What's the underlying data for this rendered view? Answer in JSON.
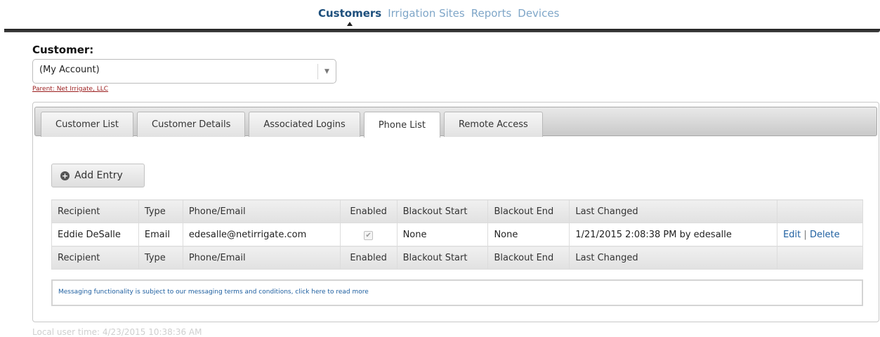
{
  "nav": {
    "items": [
      {
        "label": "Customers",
        "active": true
      },
      {
        "label": "Irrigation Sites",
        "active": false
      },
      {
        "label": "Reports",
        "active": false
      },
      {
        "label": "Devices",
        "active": false
      }
    ]
  },
  "customer": {
    "label": "Customer:",
    "selected": "(My Account)",
    "parent_link": "Parent: Net Irrigate, LLC"
  },
  "tabs": [
    {
      "label": "Customer List",
      "active": false
    },
    {
      "label": "Customer Details",
      "active": false
    },
    {
      "label": "Associated Logins",
      "active": false
    },
    {
      "label": "Phone List",
      "active": true
    },
    {
      "label": "Remote Access",
      "active": false
    }
  ],
  "phone_list": {
    "add_button": "Add Entry",
    "columns": [
      "Recipient",
      "Type",
      "Phone/Email",
      "Enabled",
      "Blackout Start",
      "Blackout End",
      "Last Changed",
      ""
    ],
    "rows": [
      {
        "recipient": "Eddie DeSalle",
        "type": "Email",
        "contact": "edesalle@netirrigate.com",
        "enabled": true,
        "blackout_start": "None",
        "blackout_end": "None",
        "last_changed": "1/21/2015 2:08:38 PM by edesalle",
        "edit": "Edit",
        "separator": "|",
        "delete": "Delete"
      }
    ],
    "notice": "Messaging functionality is subject to our messaging terms and conditions, click here to read more"
  },
  "footer": {
    "local_time": "Local user time: 4/23/2015 10:38:36 AM"
  },
  "colors": {
    "nav_active": "#1d4f7c",
    "nav_inactive": "#7fa6c8",
    "link": "#1e5fa0",
    "parent_link": "#9a1c1c"
  }
}
